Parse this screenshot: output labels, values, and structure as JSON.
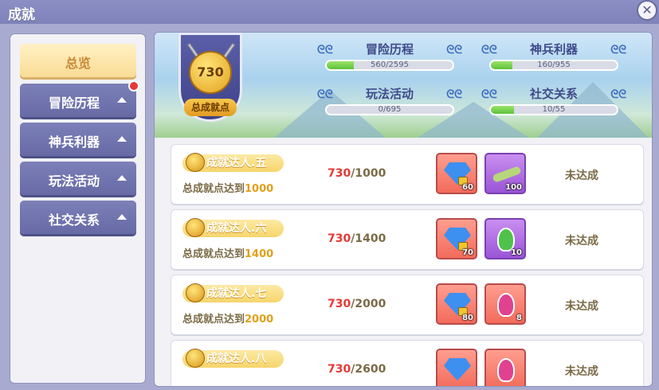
{
  "window": {
    "title": "成就",
    "close_glyph": "✕"
  },
  "sidebar": {
    "items": [
      {
        "label": "总览",
        "active": true
      },
      {
        "label": "冒险历程",
        "active": false,
        "badge": true
      },
      {
        "label": "神兵利器",
        "active": false
      },
      {
        "label": "玩法活动",
        "active": false
      },
      {
        "label": "社交关系",
        "active": false
      }
    ]
  },
  "summary": {
    "points": "730",
    "caption": "总成就点",
    "categories": [
      {
        "name": "冒险历程",
        "progress": "560/2595",
        "fraction": 0.216
      },
      {
        "name": "神兵利器",
        "progress": "160/955",
        "fraction": 0.168
      },
      {
        "name": "玩法活动",
        "progress": "0/695",
        "fraction": 0
      },
      {
        "name": "社交关系",
        "progress": "10/55",
        "fraction": 0.182
      }
    ]
  },
  "achievements": [
    {
      "title": "成就达人.五",
      "desc_prefix": "总成就点达到",
      "desc_target": "1000",
      "current": "730",
      "target": "/1000",
      "rewards": [
        {
          "icon": "diamond-icon",
          "qty": "60"
        },
        {
          "icon": "feather-icon",
          "qty": "100"
        }
      ],
      "status": "未达成"
    },
    {
      "title": "成就达人.六",
      "desc_prefix": "总成就点达到",
      "desc_target": "1400",
      "current": "730",
      "target": "/1400",
      "rewards": [
        {
          "icon": "diamond-icon",
          "qty": "70"
        },
        {
          "icon": "green-potion-icon",
          "qty": "10"
        }
      ],
      "status": "未达成"
    },
    {
      "title": "成就达人.七",
      "desc_prefix": "总成就点达到",
      "desc_target": "2000",
      "current": "730",
      "target": "/2000",
      "rewards": [
        {
          "icon": "diamond-icon",
          "qty": "80"
        },
        {
          "icon": "pink-potion-icon",
          "qty": "8"
        }
      ],
      "status": "未达成"
    },
    {
      "title": "成就达人.八",
      "desc_prefix": "",
      "desc_target": "",
      "current": "730",
      "target": "/2600",
      "rewards": [
        {
          "icon": "diamond-icon",
          "qty": ""
        },
        {
          "icon": "pink-potion-icon",
          "qty": ""
        }
      ],
      "status": "未达成"
    }
  ],
  "colors": {
    "accent_red": "#e53935",
    "gold": "#e0a01c",
    "nav_purple": "#676aa5",
    "progress_green": "#5cc23b"
  }
}
